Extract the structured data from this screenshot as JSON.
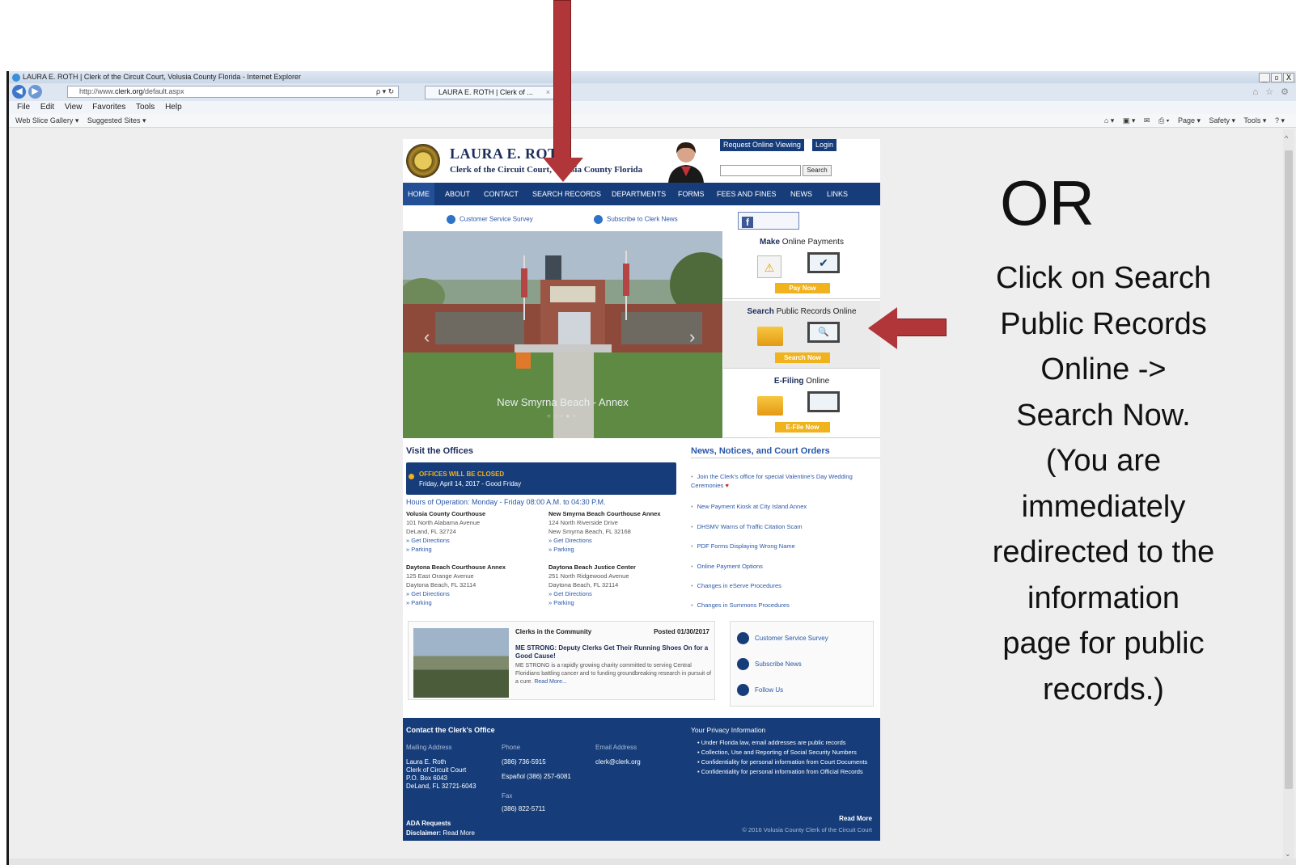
{
  "browser": {
    "window_title": "LAURA E. ROTH | Clerk of the Circuit Court, Volusia County Florida - Internet Explorer",
    "window_buttons": [
      "_",
      "▫",
      "X"
    ],
    "address_prefix": "http://www.",
    "address_domain": "clerk.org",
    "address_path": "/default.aspx",
    "address_controls": "ρ ▾ ↻",
    "tab_title": "LAURA E. ROTH | Clerk of ...",
    "tab_close": "×",
    "toolbar_icons": "⌂ ☆ ⚙",
    "menu": [
      "File",
      "Edit",
      "View",
      "Favorites",
      "Tools",
      "Help"
    ],
    "favorites": [
      "Web Slice Gallery ▾",
      "Suggested Sites ▾"
    ],
    "command_bar": [
      "⌂ ▾",
      "▣ ▾",
      "✉",
      "⎙ ▾",
      "Page ▾",
      "Safety ▾",
      "Tools ▾",
      "? ▾"
    ],
    "scroll_up": "^",
    "scroll_down": "⌄"
  },
  "site": {
    "name": "LAURA E. ROTH",
    "subtitle": "Clerk of the Circuit Court, Volusia County Florida",
    "request_viewing": "Request Online Viewing",
    "login": "Login",
    "search_button": "Search",
    "nav": [
      "HOME",
      "ABOUT",
      "CONTACT",
      "SEARCH RECORDS",
      "DEPARTMENTS",
      "FORMS",
      "FEES AND FINES",
      "NEWS",
      "LINKS"
    ],
    "service_survey": "Customer Service Survey",
    "subscribe": "Subscribe to Clerk News",
    "facebook": "facebook",
    "facebook_logo": "f",
    "slider_caption": "New Smyrna Beach - Annex",
    "slider_dots": "○○○●○",
    "slider_prev": "‹",
    "slider_next": "›",
    "pay_title_bold": "Make",
    "pay_title_rest": " Online Payments",
    "pay_button": "Pay Now",
    "pay_check": "✔",
    "pay_warning": "⚠",
    "search_title_bold": "Search",
    "search_title_rest": " Public Records Online",
    "search_now": "Search Now",
    "magnifier": "🔍",
    "efile_title_bold": "E-Filing",
    "efile_title_rest": " Online",
    "efile_button": "E-File Now",
    "visit_heading": "Visit the Offices",
    "closed_title": "OFFICES WILL BE CLOSED",
    "closed_date": "Friday, April 14, 2017 - Good Friday",
    "hours": "Hours of Operation: Monday - Friday 08:00 A.M. to 04:30 P.M.",
    "offices": [
      {
        "name": "Volusia County Courthouse",
        "l1": "101 North Alabama Avenue",
        "l2": "DeLand, FL 32724",
        "d": "» Get Directions",
        "p": "» Parking"
      },
      {
        "name": "New Smyrna Beach Courthouse Annex",
        "l1": "124 North Riverside Drive",
        "l2": "New Smyrna Beach, FL 32168",
        "d": "» Get Directions",
        "p": "» Parking"
      },
      {
        "name": "Daytona Beach Courthouse Annex",
        "l1": "125 East Orange Avenue",
        "l2": "Daytona Beach, FL 32114",
        "d": "» Get Directions",
        "p": "» Parking"
      },
      {
        "name": "Daytona Beach Justice Center",
        "l1": "251 North Ridgewood Avenue",
        "l2": "Daytona Beach, FL 32114",
        "d": "» Get Directions",
        "p": "» Parking"
      }
    ],
    "news_heading": "News, Notices, and Court Orders",
    "news": [
      "Join the Clerk's office for special Valentine's Day Wedding Ceremonies",
      "New Payment Kiosk at City Island Annex",
      "DHSMV Warns of Traffic Citation Scam",
      "PDF Forms Displaying Wrong Name",
      "Online Payment Options",
      "Changes in eServe Procedures",
      "Changes in Summons Procedures"
    ],
    "heart": "♥",
    "community_heading": "Clerks in the Community",
    "community_date": "Posted 01/30/2017",
    "community_title": "ME STRONG: Deputy Clerks Get Their Running Shoes On for a Good Cause!",
    "community_body": "ME STRONG is a rapidly growing charity committed to serving Central Floridians battling cancer and to funding groundbreaking research in pursuit of a cure.",
    "read_more": "Read More...",
    "quick_links": [
      "Customer Service Survey",
      "Subscribe News",
      "Follow Us"
    ],
    "footer": {
      "contact_heading": "Contact the Clerk's Office",
      "mailing_label": "Mailing Address",
      "mailing": [
        "Laura E. Roth",
        "Clerk of Circuit Court",
        "P.O. Box 6043",
        "DeLand, FL 32721-6043"
      ],
      "phone_label": "Phone",
      "phone": "(386) 736-5915",
      "espanol": "Español (386) 257-6081",
      "fax_label": "Fax",
      "fax": "(386) 822-5711",
      "email_label": "Email Address",
      "email": "clerk@clerk.org",
      "ada": "ADA Requests",
      "disclaimer": "Disclaimer:",
      "disclaimer_link": "Read More",
      "privacy_heading": "Your Privacy Information",
      "privacy": [
        "Under Florida law, email addresses are public records",
        "Collection, Use and Reporting of Social Security Numbers",
        "Confidentiality for personal information from Court Documents",
        "Confidentiality for personal information from Official Records"
      ],
      "privacy_more": "Read More",
      "copyright": "© 2016 Volusia County Clerk of the Circuit Court"
    }
  },
  "annotation": {
    "or": "OR",
    "instruction": "Click on Search Public Records Online -> Search Now. (You are immediately redirected to the information page for public records.)",
    "arrow_color": "#b0363a"
  }
}
